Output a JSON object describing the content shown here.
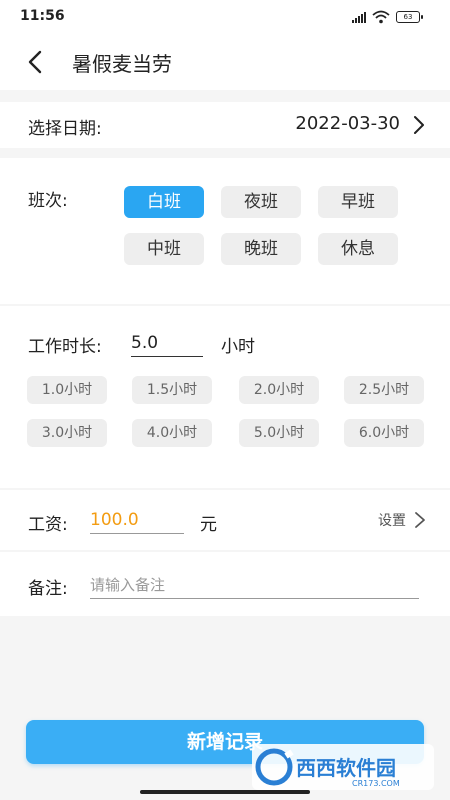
{
  "status_bar": {
    "time": "11:56",
    "battery": "63"
  },
  "header": {
    "title": "暑假麦当劳"
  },
  "date": {
    "label": "选择日期:",
    "value": "2022-03-30"
  },
  "shift": {
    "label": "班次:",
    "options": [
      "白班",
      "夜班",
      "早班",
      "中班",
      "晚班",
      "休息"
    ],
    "selected": "白班"
  },
  "hours": {
    "label": "工作时长:",
    "value": "5.0",
    "unit": "小时",
    "presets": [
      "1.0小时",
      "1.5小时",
      "2.0小时",
      "2.5小时",
      "3.0小时",
      "4.0小时",
      "5.0小时",
      "6.0小时"
    ]
  },
  "wage": {
    "label": "工资:",
    "value": "100.0",
    "unit": "元",
    "settings_label": "设置"
  },
  "note": {
    "label": "备注:",
    "placeholder": "请输入备注",
    "value": ""
  },
  "submit": {
    "label": "新增记录"
  },
  "watermark": {
    "text": "西西软件园",
    "domain": "CR173.COM"
  },
  "colors": {
    "accent": "#2aa6f2",
    "wage_value": "#f39c12",
    "chip_bg": "#eeeeee",
    "page_bg": "#f5f5f5"
  },
  "icons": [
    "back-arrow-icon",
    "chevron-right-icon",
    "signal-icon",
    "wifi-icon",
    "battery-icon"
  ]
}
